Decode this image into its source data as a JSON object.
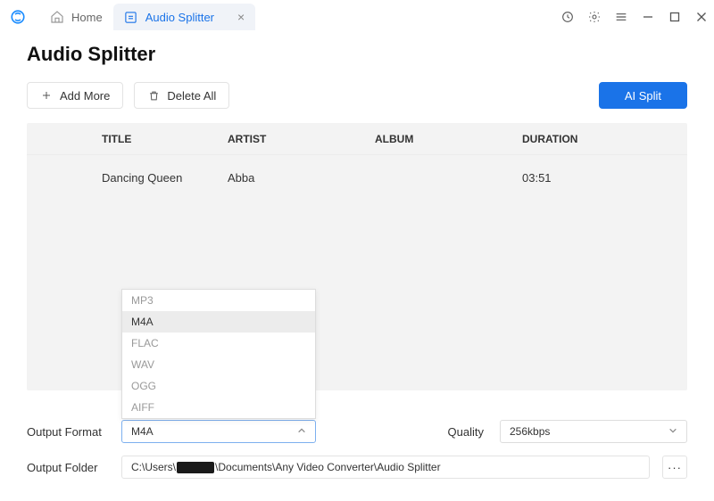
{
  "tabs": {
    "home": "Home",
    "active": "Audio Splitter"
  },
  "page_title": "Audio Splitter",
  "toolbar": {
    "add_more": "Add More",
    "delete_all": "Delete All",
    "ai_split": "AI Split"
  },
  "table": {
    "headers": {
      "title": "TITLE",
      "artist": "ARTIST",
      "album": "ALBUM",
      "duration": "DURATION"
    },
    "rows": [
      {
        "title": "Dancing Queen",
        "artist": "Abba",
        "album": "",
        "duration": "03:51"
      }
    ]
  },
  "format_dropdown": {
    "options": [
      "MP3",
      "M4A",
      "FLAC",
      "WAV",
      "OGG",
      "AIFF"
    ],
    "selected": "M4A"
  },
  "output_format_label": "Output Format",
  "quality_label": "Quality",
  "quality_value": "256kbps",
  "output_folder_label": "Output Folder",
  "output_folder_prefix": "C:\\Users\\",
  "output_folder_suffix": "\\Documents\\Any Video Converter\\Audio Splitter",
  "browse": "···"
}
